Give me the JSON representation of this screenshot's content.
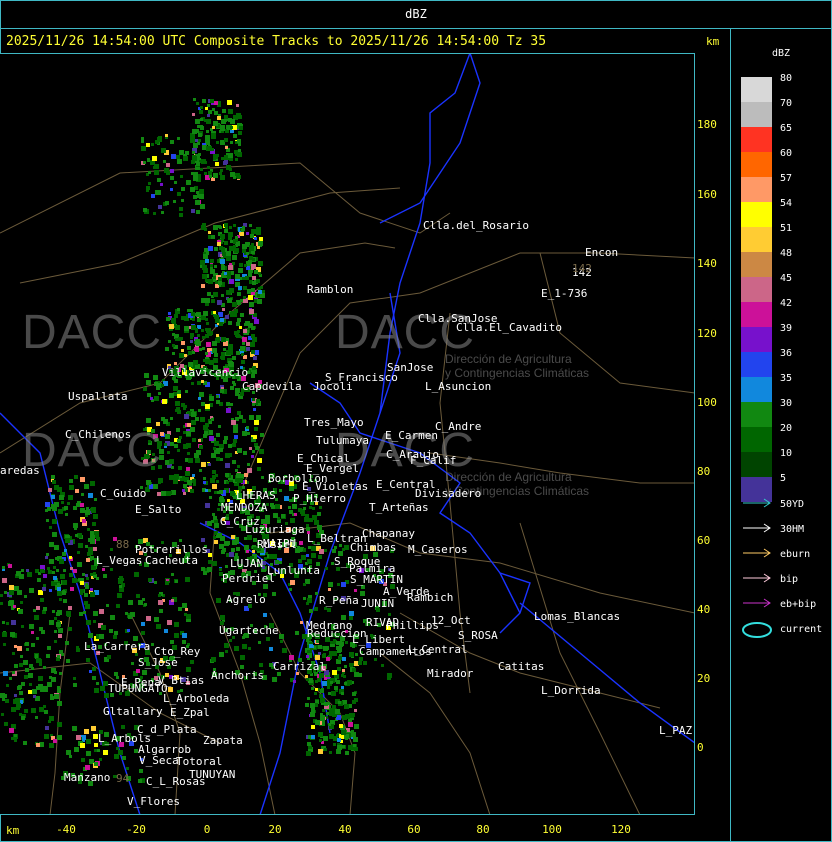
{
  "window": {
    "title": "dBZ"
  },
  "header": {
    "text": "2025/11/26 14:54:00 UTC Composite Tracks to 2025/11/26 14:54:00 Tz 35",
    "km_label": "km"
  },
  "axes": {
    "x_label": "km",
    "x_ticks": [
      "-40",
      "-20",
      "0",
      "20",
      "40",
      "60",
      "80",
      "100",
      "120"
    ],
    "y_ticks": [
      "180",
      "160",
      "140",
      "120",
      "100",
      "80",
      "60",
      "40",
      "20",
      "0"
    ]
  },
  "watermark": {
    "brand": "DACC",
    "line1": "Dirección de Agricultura",
    "line2": "y Contingencias Climáticas"
  },
  "places": [
    {
      "name": "Clla.del_Rosario"
    },
    {
      "name": "Encon"
    },
    {
      "name": "142"
    },
    {
      "name": "E_1-736"
    },
    {
      "name": "Ramblon"
    },
    {
      "name": "Clla.SanJose"
    },
    {
      "name": "Clla.El_Cavadito"
    },
    {
      "name": "Villavicencio"
    },
    {
      "name": "Capdevila"
    },
    {
      "name": "S_Francisco"
    },
    {
      "name": "SanJose"
    },
    {
      "name": "L_Asuncion"
    },
    {
      "name": "Jocoli"
    },
    {
      "name": "Uspallata"
    },
    {
      "name": "Tres_Mayo"
    },
    {
      "name": "C_Andre"
    },
    {
      "name": "E_Carmen"
    },
    {
      "name": "C_Chilenos"
    },
    {
      "name": "Tulumaya"
    },
    {
      "name": "E_Chical"
    },
    {
      "name": "E_Vergel"
    },
    {
      "name": "C_Araujo"
    },
    {
      "name": "F_Calif"
    },
    {
      "name": "aredas"
    },
    {
      "name": "Borbollon"
    },
    {
      "name": "E_Violetas"
    },
    {
      "name": "E_Central"
    },
    {
      "name": "Divisadero"
    },
    {
      "name": "C_Guido"
    },
    {
      "name": "LHERAS"
    },
    {
      "name": "P_Hierro"
    },
    {
      "name": "E_Salto"
    },
    {
      "name": "MENDOZA"
    },
    {
      "name": "T_Arteñas"
    },
    {
      "name": "G_Cruz"
    },
    {
      "name": "Luzuriaga"
    },
    {
      "name": "Chapanay"
    },
    {
      "name": "Russel"
    },
    {
      "name": "L_Beltran"
    },
    {
      "name": "Potrerillos"
    },
    {
      "name": "MAIPU"
    },
    {
      "name": "Chimbas"
    },
    {
      "name": "M_Caseros"
    },
    {
      "name": "L_Vegas"
    },
    {
      "name": "Cacheuta"
    },
    {
      "name": "S_Roque"
    },
    {
      "name": "LUJAN"
    },
    {
      "name": "Lunlunta"
    },
    {
      "name": "Palmira"
    },
    {
      "name": "Perdriel"
    },
    {
      "name": "S_MARTIN"
    },
    {
      "name": "A_Verde"
    },
    {
      "name": "Agrelo"
    },
    {
      "name": "R_Peña"
    },
    {
      "name": "JUNIN"
    },
    {
      "name": "Rambich"
    },
    {
      "name": "Lomas_Blancas"
    },
    {
      "name": "Ugarteche"
    },
    {
      "name": "Medrano"
    },
    {
      "name": "RIVAD"
    },
    {
      "name": "Phillips"
    },
    {
      "name": "12_Oct"
    },
    {
      "name": "Reduccion"
    },
    {
      "name": "S_ROSA"
    },
    {
      "name": "La_Carrera"
    },
    {
      "name": "Cto_Rey"
    },
    {
      "name": "L_Libert"
    },
    {
      "name": "Campamentos"
    },
    {
      "name": "L_Central"
    },
    {
      "name": "S_Jose"
    },
    {
      "name": "Carrizal"
    },
    {
      "name": "Catitas"
    },
    {
      "name": "Anchoris"
    },
    {
      "name": "V_Btias"
    },
    {
      "name": "E_Pena"
    },
    {
      "name": "TUPUNGATO"
    },
    {
      "name": "Mirador"
    },
    {
      "name": "L_Dorrida"
    },
    {
      "name": "L_Arboleda"
    },
    {
      "name": "Gltallary"
    },
    {
      "name": "E_Zpal"
    },
    {
      "name": "C_d_Plata"
    },
    {
      "name": "L_Arbols"
    },
    {
      "name": "Zapata"
    },
    {
      "name": "L_PAZ"
    },
    {
      "name": "Algarrob"
    },
    {
      "name": "V_Seca"
    },
    {
      "name": "Totoral"
    },
    {
      "name": "TUNUYAN"
    },
    {
      "name": "Manzano"
    },
    {
      "name": "C_L_Rosas"
    },
    {
      "name": "V_Flores"
    },
    {
      "name": "142"
    },
    {
      "name": "88"
    },
    {
      "name": "94"
    }
  ],
  "legend": {
    "title": "dBZ",
    "bins": [
      {
        "label": "80",
        "color": "#d8d8d8"
      },
      {
        "label": "70",
        "color": "#bcbcbc"
      },
      {
        "label": "65",
        "color": "#ff3322"
      },
      {
        "label": "60",
        "color": "#ff6600"
      },
      {
        "label": "57",
        "color": "#ff9966"
      },
      {
        "label": "54",
        "color": "#ffff00"
      },
      {
        "label": "51",
        "color": "#ffcc33"
      },
      {
        "label": "48",
        "color": "#cc8844"
      },
      {
        "label": "45",
        "color": "#cc6688"
      },
      {
        "label": "42",
        "color": "#cc1199"
      },
      {
        "label": "39",
        "color": "#7711cc"
      },
      {
        "label": "36",
        "color": "#2244ee"
      },
      {
        "label": "35",
        "color": "#1188dd"
      },
      {
        "label": "30",
        "color": "#118811"
      },
      {
        "label": "20",
        "color": "#006600"
      },
      {
        "label": "10",
        "color": "#004400"
      },
      {
        "label": "5",
        "color": "#443399"
      }
    ],
    "tracks": [
      {
        "label": "50YD",
        "color": "#33cccc",
        "icon": "arrow-icon"
      },
      {
        "label": "30HM",
        "color": "#ffffff",
        "icon": "arrow-icon"
      },
      {
        "label": "eburn",
        "color": "#ffcc66",
        "icon": "arrow-icon"
      },
      {
        "label": "bip",
        "color": "#ffccdd",
        "icon": "arrow-icon"
      },
      {
        "label": "eb+bip",
        "color": "#cc33cc",
        "icon": "arrow-icon"
      },
      {
        "label": "current",
        "color": "#33dddd",
        "icon": "ellipse-icon"
      }
    ]
  },
  "colors": {
    "frame": "#3fb7c4",
    "axis_text": "#ffff33",
    "border_lines": "#1a33ff",
    "roads": "#6b5a3a"
  }
}
